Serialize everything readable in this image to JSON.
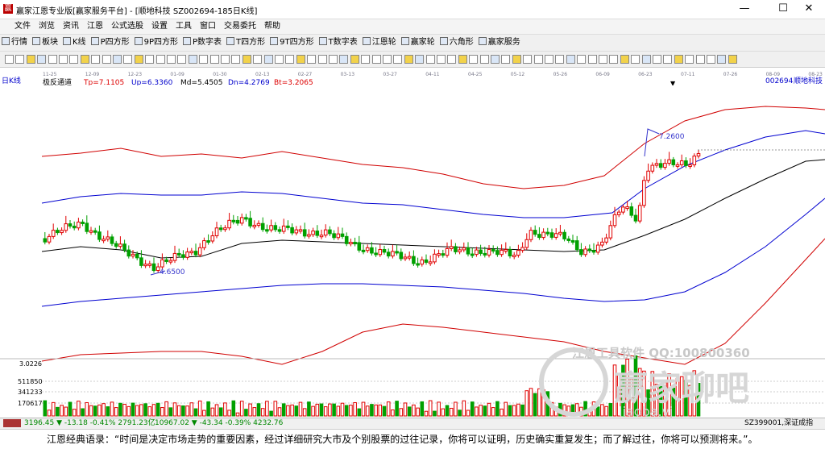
{
  "titlebar": {
    "title": "赢家江恩专业版[赢家服务平台] - [顺地科技  SZ002694-185日K线]",
    "min": "—",
    "max": "☐",
    "close": "✕"
  },
  "menu": [
    "文件",
    "浏览",
    "资讯",
    "江恩",
    "公式选股",
    "设置",
    "工具",
    "窗口",
    "交易委托",
    "帮助"
  ],
  "toolbar": [
    "行情",
    "板块",
    "K线",
    "P四方形",
    "9P四方形",
    "P数字表",
    "T四方形",
    "9T四方形",
    "T数字表",
    "江恩轮",
    "赢家轮",
    "六角形",
    "赢家服务"
  ],
  "dates": [
    "11-25",
    "12-09",
    "12-23",
    "01-09",
    "01-30",
    "02-13",
    "02-27",
    "03-13",
    "03-27",
    "04-11",
    "04-25",
    "05-12",
    "05-26",
    "06-09",
    "06-23",
    "07-11",
    "07-26",
    "08-09",
    "08-23"
  ],
  "panel": {
    "period": "日K线",
    "indicator": "极反通道",
    "tp": "Tp=7.1105",
    "up": "Up=6.3360",
    "md": "Md=5.4505",
    "dn": "Dn=4.2769",
    "bt": "Bt=3.2065",
    "code": "002694",
    "name": "顺地科技"
  },
  "annotations": {
    "high": "7.2600",
    "low": "4.6500",
    "bottom_label": "3.0226"
  },
  "volume_axis": [
    "511850",
    "341233",
    "170617"
  ],
  "watermark": {
    "line1": "江恩工具软件  QQ:100800360",
    "line2": "赢家聊吧",
    "line3": "liaoba.yj"
  },
  "status": {
    "sh": "3196.45 ▼ -13.18 -0.41% 2791.23亿",
    "sz": "10967.02 ▼ -43.34 -0.39% 4232.76",
    "index": "SZ399001,深证成指"
  },
  "quote": "江恩经典语录：“时间是决定市场走势的重要因素，经过详细研究大市及个别股票的过往记录，你将可以证明，历史确实重复发生；而了解过往，你将可以预测将来。”。",
  "colors": {
    "up": "#e00000",
    "down": "#00a000",
    "tp": "#e00000",
    "up_band": "#0000e0",
    "md": "#000000"
  },
  "chart_data": {
    "type": "candlestick",
    "price_labels": {
      "high": 7.26,
      "low": 4.65
    },
    "bands": {
      "Tp": 7.1105,
      "Up": 6.336,
      "Md": 5.4505,
      "Dn": 4.2769,
      "Bt": 3.2065
    },
    "volume_ticks": [
      511850,
      341233,
      170617
    ]
  }
}
